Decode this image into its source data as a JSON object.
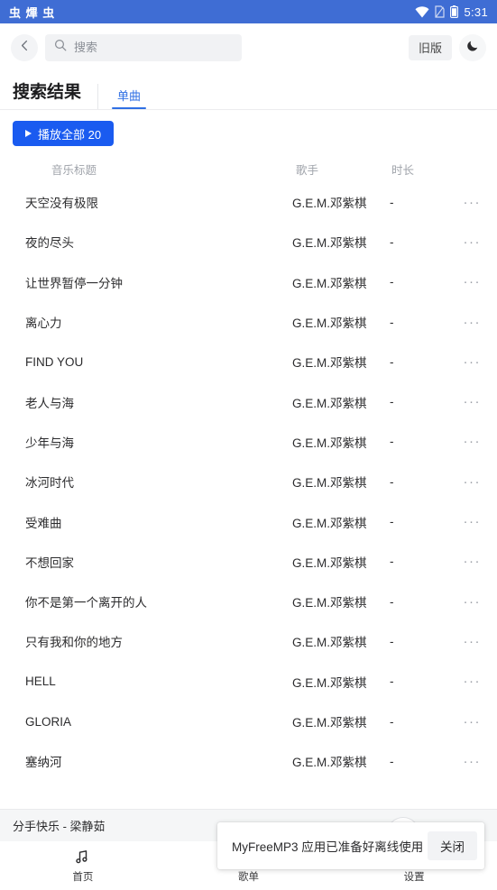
{
  "status_bar": {
    "left_glyphs": "虫 熚 虫",
    "time": "5:31",
    "icons": [
      "wifi-icon",
      "sim-icon",
      "battery-icon"
    ],
    "background": "#3f6dd4"
  },
  "header": {
    "back_icon": "chevron-left-icon",
    "search": {
      "icon": "search-icon",
      "value": "",
      "placeholder": "搜索"
    },
    "legacy_label": "旧版",
    "theme_icon": "moon-icon"
  },
  "result_section": {
    "title": "搜索结果",
    "tabs": [
      {
        "label": "单曲",
        "active": true
      }
    ]
  },
  "play_all": {
    "icon": "play-triangle-icon",
    "label": "播放全部 20"
  },
  "table": {
    "columns": {
      "title": "音乐标题",
      "artist": "歌手",
      "duration": "时长"
    },
    "more_icon": "ellipsis-icon",
    "rows": [
      {
        "title": "天空没有极限",
        "artist": "G.E.M.邓紫棋",
        "duration": "-",
        "more": "···"
      },
      {
        "title": "夜的尽头",
        "artist": "G.E.M.邓紫棋",
        "duration": "-",
        "more": "···"
      },
      {
        "title": "让世界暂停一分钟",
        "artist": "G.E.M.邓紫棋",
        "duration": "-",
        "more": "···"
      },
      {
        "title": "离心力",
        "artist": "G.E.M.邓紫棋",
        "duration": "-",
        "more": "···"
      },
      {
        "title": "FIND YOU",
        "artist": "G.E.M.邓紫棋",
        "duration": "-",
        "more": "···"
      },
      {
        "title": "老人与海",
        "artist": "G.E.M.邓紫棋",
        "duration": "-",
        "more": "···"
      },
      {
        "title": "少年与海",
        "artist": "G.E.M.邓紫棋",
        "duration": "-",
        "more": "···"
      },
      {
        "title": "冰河时代",
        "artist": "G.E.M.邓紫棋",
        "duration": "-",
        "more": "···"
      },
      {
        "title": "受难曲",
        "artist": "G.E.M.邓紫棋",
        "duration": "-",
        "more": "···"
      },
      {
        "title": "不想回家",
        "artist": "G.E.M.邓紫棋",
        "duration": "-",
        "more": "···"
      },
      {
        "title": "你不是第一个离开的人",
        "artist": "G.E.M.邓紫棋",
        "duration": "-",
        "more": "···"
      },
      {
        "title": "只有我和你的地方",
        "artist": "G.E.M.邓紫棋",
        "duration": "-",
        "more": "···"
      },
      {
        "title": "HELL",
        "artist": "G.E.M.邓紫棋",
        "duration": "-",
        "more": "···"
      },
      {
        "title": "GLORIA",
        "artist": "G.E.M.邓紫棋",
        "duration": "-",
        "more": "···"
      },
      {
        "title": "塞纳河",
        "artist": "G.E.M.邓紫棋",
        "duration": "-",
        "more": "···"
      }
    ]
  },
  "now_playing": {
    "title": "分手快乐 - 梁静茹"
  },
  "bottom_nav": {
    "items": [
      {
        "label": "首页",
        "icon": "music-note-icon",
        "active": true
      },
      {
        "label": "歌单",
        "icon": "playlist-icon",
        "active": false
      },
      {
        "label": "设置",
        "icon": "settings-icon",
        "active": false
      }
    ]
  },
  "toast": {
    "message": "MyFreeMP3 应用已准备好离线使用",
    "button_label": "关闭"
  },
  "colors": {
    "status_bar": "#3f6dd4",
    "primary_button": "#1a5bf0",
    "tab_active": "#2f6fe4",
    "text": "#2c2c2e",
    "muted": "#a0a4ab"
  }
}
